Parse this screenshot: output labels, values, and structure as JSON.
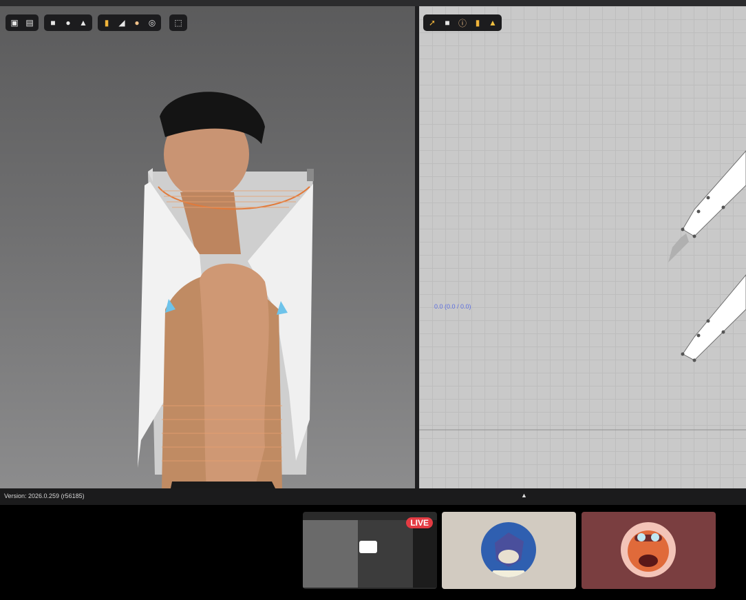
{
  "app": {
    "version": "Version: 2026.0.259 (r56185)",
    "coordinate_readout": "0.0 (0.0 / 0.0)",
    "panel_toggle_glyph": "▲"
  },
  "viewport3d_toolbar": {
    "groups": [
      [
        {
          "icon": "cube-icon"
        },
        {
          "icon": "shirt-cube-icon"
        }
      ],
      [
        {
          "icon": "tshirt-icon"
        },
        {
          "icon": "fabric-icon"
        },
        {
          "icon": "avatar-icon"
        }
      ],
      [
        {
          "icon": "texture-icon"
        },
        {
          "icon": "surface-icon"
        },
        {
          "icon": "skin-icon"
        },
        {
          "icon": "globe-icon"
        }
      ],
      [
        {
          "icon": "select-icon"
        }
      ]
    ]
  },
  "viewport2d_toolbar": {
    "icons": [
      "edit-pattern-icon",
      "tshirt-icon",
      "info-icon",
      "texture-icon",
      "garment-icon"
    ]
  },
  "meeting": {
    "live_badge": "LIVE",
    "tiles": [
      {
        "name": "screen-share",
        "background": "#2a2a2a"
      },
      {
        "name": "participant-wolf",
        "background": "#d2cbc1"
      },
      {
        "name": "participant-tiger",
        "background": "#7a3e40"
      }
    ]
  },
  "colors": {
    "viewport_bg_top": "#5b5b5c",
    "grid_bg": "#c9c9c9",
    "accent_live": "#e43b43",
    "coord_text": "#5a6ce0"
  }
}
